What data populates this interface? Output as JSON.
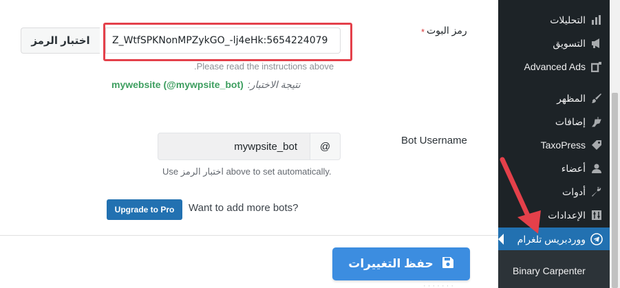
{
  "form": {
    "token_label": "رمز البوت",
    "required_mark": "*",
    "test_button_label": "اختبار الرمز",
    "token_value": "Z_WtfSPKNonMPZykGO_-lj4eHk:5654224079",
    "instructions": ".Please read the instructions above",
    "test_result_label": "نتيجة الاختبار:",
    "test_result_value": "mywebsite (@mywpsite_bot)",
    "bot_username_label": "Bot Username",
    "bot_username_value": "mywpsite_bot",
    "at_symbol": "@",
    "bot_username_help": "Use اختبار الرمز above to set automatically.",
    "upgrade_button_label": "Upgrade to Pro",
    "upgrade_prompt": "Want to add more bots?",
    "save_button_label": "حفظ التغييرات",
    "bottom_faint_text": "· · ·  · · · ·"
  },
  "sidebar": {
    "items": [
      {
        "label": "التحليلات",
        "icon": "bar-chart-icon"
      },
      {
        "label": "التسويق",
        "icon": "megaphone-icon"
      },
      {
        "label": "Advanced Ads",
        "icon": "ads-icon"
      },
      {
        "label": "المظهر",
        "icon": "paintbrush-icon"
      },
      {
        "label": "إضافات",
        "icon": "plug-icon"
      },
      {
        "label": "TaxoPress",
        "icon": "tag-icon"
      },
      {
        "label": "أعضاء",
        "icon": "user-icon"
      },
      {
        "label": "أدوات",
        "icon": "wrench-icon"
      },
      {
        "label": "الإعدادات",
        "icon": "settings-icon"
      },
      {
        "label": "ووردبريس تلغرام",
        "icon": "telegram-icon",
        "active": true
      }
    ],
    "submenu_item": "Binary Carpenter"
  },
  "colors": {
    "accent": "#2271b1",
    "save_button": "#3c8de0",
    "highlight_box": "#e4404a",
    "result_green": "#3d9e5f",
    "sidebar_bg": "#1d2327",
    "annotation_arrow": "#e4404a"
  }
}
